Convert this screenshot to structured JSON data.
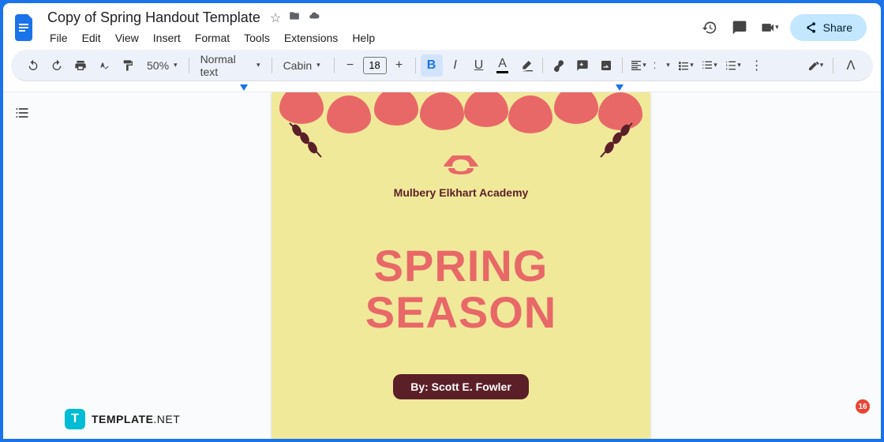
{
  "header": {
    "doc_title": "Copy of Spring Handout Template",
    "menus": [
      "File",
      "Edit",
      "View",
      "Insert",
      "Format",
      "Tools",
      "Extensions",
      "Help"
    ],
    "share_label": "Share"
  },
  "toolbar": {
    "zoom": "50%",
    "style": "Normal text",
    "font": "Cabin",
    "font_size": "18"
  },
  "document": {
    "academy_name": "Mulbery Elkhart Academy",
    "title_line1": "SPRING",
    "title_line2": "SEASON",
    "byline": "By: Scott E. Fowler"
  },
  "watermark": {
    "brand": "TEMPLATE",
    "suffix": ".NET"
  },
  "badge": "16",
  "colors": {
    "accent_blue": "#1a73e8",
    "flower": "#e86868",
    "leaf": "#5b1f28",
    "bg_page": "#f0e99a",
    "share_bg": "#c2e7ff"
  }
}
